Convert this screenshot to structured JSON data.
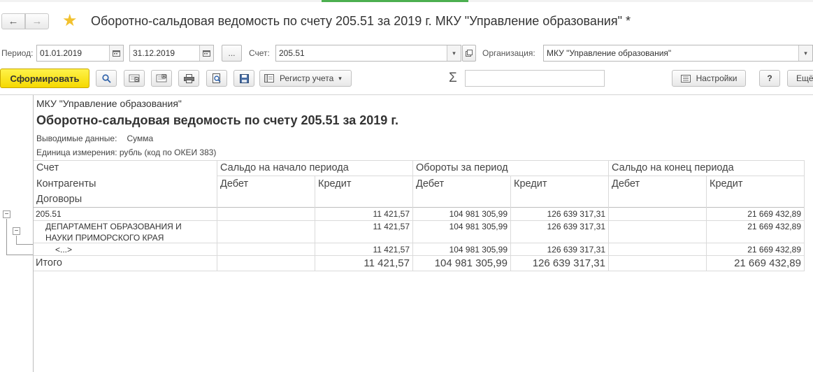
{
  "window": {
    "title": "Оборотно-сальдовая ведомость по счету 205.51 за 2019 г. МКУ \"Управление образования\" *",
    "back_glyph": "←",
    "forward_glyph": "→",
    "favorite_glyph": "★"
  },
  "params": {
    "period_label": "Период:",
    "period_from": "01.01.2019",
    "period_to": "31.12.2019",
    "ellipsis": "...",
    "account_label": "Счет:",
    "account_value": "205.51",
    "org_label": "Организация:",
    "org_value": "МКУ \"Управление образования\""
  },
  "toolbar": {
    "generate_label": "Сформировать",
    "register_label": "Регистр учета",
    "sigma": "Σ",
    "settings_label": "Настройки",
    "help_label": "?",
    "more_label": "Ещё"
  },
  "report": {
    "org": "МКУ \"Управление образования\"",
    "title": "Оборотно-сальдовая ведомость по счету 205.51 за 2019 г.",
    "output_label": "Выводимые данные:",
    "output_value": "Сумма",
    "unit_line": "Единица измерения: рубль (код по ОКЕИ 383)",
    "headers": {
      "account": "Счет",
      "counterparties": "Контрагенты",
      "contracts": "Договоры",
      "opening": "Сальдо на начало периода",
      "turnover": "Обороты за период",
      "closing": "Сальдо на конец периода",
      "debit": "Дебет",
      "credit": "Кредит"
    },
    "rows": [
      {
        "name": "205.51",
        "ob_debit": "",
        "ob_credit": "11 421,57",
        "t_debit": "104 981 305,99",
        "t_credit": "126 639 317,31",
        "cb_debit": "",
        "cb_credit": "21 669 432,89"
      },
      {
        "name_line1": "ДЕПАРТАМЕНТ ОБРАЗОВАНИЯ И",
        "name_line2": "НАУКИ ПРИМОРСКОГО КРАЯ",
        "ob_debit": "",
        "ob_credit": "11 421,57",
        "t_debit": "104 981 305,99",
        "t_credit": "126 639 317,31",
        "cb_debit": "",
        "cb_credit": "21 669 432,89"
      },
      {
        "name": "<...>",
        "ob_debit": "",
        "ob_credit": "11 421,57",
        "t_debit": "104 981 305,99",
        "t_credit": "126 639 317,31",
        "cb_debit": "",
        "cb_credit": "21 669 432,89"
      }
    ],
    "total": {
      "name": "Итого",
      "ob_credit": "11 421,57",
      "t_debit": "104 981 305,99",
      "t_credit": "126 639 317,31",
      "cb_credit": "21 669 432,89"
    },
    "tree_minus": "−"
  }
}
